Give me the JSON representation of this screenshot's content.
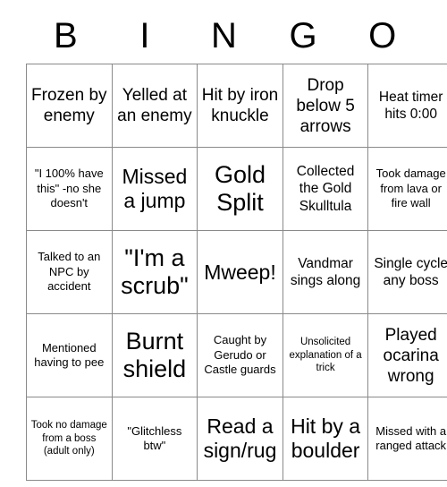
{
  "card": {
    "title": "BINGO",
    "headers": [
      "B",
      "I",
      "N",
      "G",
      "O"
    ],
    "rows": [
      [
        {
          "text": "Frozen by enemy",
          "size": "sz-l"
        },
        {
          "text": "Yelled at an enemy",
          "size": "sz-l"
        },
        {
          "text": "Hit by iron knuckle",
          "size": "sz-l"
        },
        {
          "text": "Drop below 5 arrows",
          "size": "sz-l"
        },
        {
          "text": "Heat timer hits 0:00",
          "size": "sz-m"
        }
      ],
      [
        {
          "text": "\"I 100% have this\" -no she doesn't",
          "size": "sz-s"
        },
        {
          "text": "Missed a jump",
          "size": "sz-xl"
        },
        {
          "text": "Gold Split",
          "size": "sz-xxl"
        },
        {
          "text": "Collected the Gold Skulltula",
          "size": "sz-m"
        },
        {
          "text": "Took damage from lava or fire wall",
          "size": "sz-s"
        }
      ],
      [
        {
          "text": "Talked to an NPC by accident",
          "size": "sz-s"
        },
        {
          "text": "\"I'm a scrub\"",
          "size": "sz-xxl"
        },
        {
          "text": "Mweep!",
          "size": "sz-xl"
        },
        {
          "text": "Vandmar sings along",
          "size": "sz-m"
        },
        {
          "text": "Single cycle any boss",
          "size": "sz-m"
        }
      ],
      [
        {
          "text": "Mentioned having to pee",
          "size": "sz-s"
        },
        {
          "text": "Burnt shield",
          "size": "sz-xxl"
        },
        {
          "text": "Caught by Gerudo or Castle guards",
          "size": "sz-s"
        },
        {
          "text": "Unsolicited explanation of a trick",
          "size": "sz-xs"
        },
        {
          "text": "Played ocarina wrong",
          "size": "sz-l"
        }
      ],
      [
        {
          "text": "Took no damage from a boss (adult only)",
          "size": "sz-xs"
        },
        {
          "text": "\"Glitchless btw\"",
          "size": "sz-s"
        },
        {
          "text": "Read a sign/rug",
          "size": "sz-xl"
        },
        {
          "text": "Hit by a boulder",
          "size": "sz-xl"
        },
        {
          "text": "Missed with a ranged attack",
          "size": "sz-s"
        }
      ]
    ]
  },
  "colors": {
    "background": "#ffffff",
    "text": "#000000",
    "grid_border": "#8a8a8a"
  }
}
